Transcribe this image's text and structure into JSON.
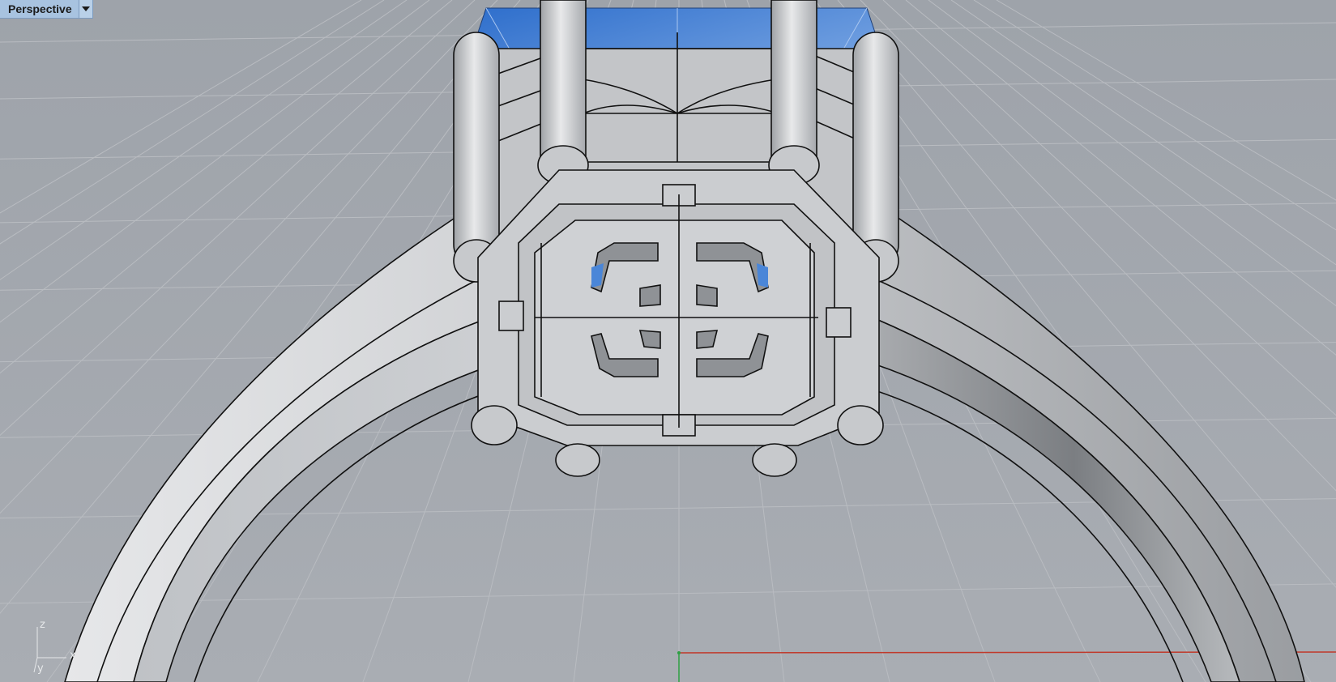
{
  "viewport": {
    "name": "Perspective"
  },
  "axes": {
    "z": "z",
    "x": "x",
    "y": "y"
  },
  "colors": {
    "background": "#a3a7ad",
    "metal": "#c9cbce",
    "gem": "#4a86d8",
    "grid": "#b9bcc1",
    "x_axis": "#c0392b",
    "y_axis": "#2ea043",
    "tab": "#a8c3e0"
  },
  "icons": {
    "viewport_menu": "chevron-down-icon"
  }
}
